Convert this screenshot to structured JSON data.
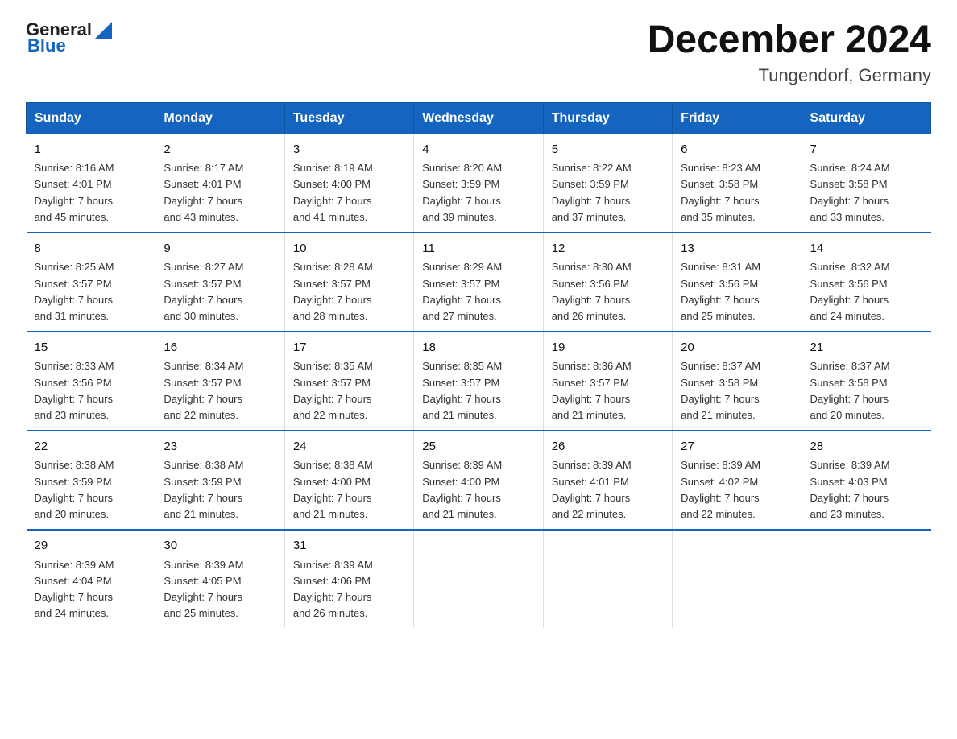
{
  "header": {
    "logo_general": "General",
    "logo_blue": "Blue",
    "title": "December 2024",
    "subtitle": "Tungendorf, Germany"
  },
  "weekdays": [
    "Sunday",
    "Monday",
    "Tuesday",
    "Wednesday",
    "Thursday",
    "Friday",
    "Saturday"
  ],
  "weeks": [
    [
      {
        "day": "1",
        "info": "Sunrise: 8:16 AM\nSunset: 4:01 PM\nDaylight: 7 hours\nand 45 minutes."
      },
      {
        "day": "2",
        "info": "Sunrise: 8:17 AM\nSunset: 4:01 PM\nDaylight: 7 hours\nand 43 minutes."
      },
      {
        "day": "3",
        "info": "Sunrise: 8:19 AM\nSunset: 4:00 PM\nDaylight: 7 hours\nand 41 minutes."
      },
      {
        "day": "4",
        "info": "Sunrise: 8:20 AM\nSunset: 3:59 PM\nDaylight: 7 hours\nand 39 minutes."
      },
      {
        "day": "5",
        "info": "Sunrise: 8:22 AM\nSunset: 3:59 PM\nDaylight: 7 hours\nand 37 minutes."
      },
      {
        "day": "6",
        "info": "Sunrise: 8:23 AM\nSunset: 3:58 PM\nDaylight: 7 hours\nand 35 minutes."
      },
      {
        "day": "7",
        "info": "Sunrise: 8:24 AM\nSunset: 3:58 PM\nDaylight: 7 hours\nand 33 minutes."
      }
    ],
    [
      {
        "day": "8",
        "info": "Sunrise: 8:25 AM\nSunset: 3:57 PM\nDaylight: 7 hours\nand 31 minutes."
      },
      {
        "day": "9",
        "info": "Sunrise: 8:27 AM\nSunset: 3:57 PM\nDaylight: 7 hours\nand 30 minutes."
      },
      {
        "day": "10",
        "info": "Sunrise: 8:28 AM\nSunset: 3:57 PM\nDaylight: 7 hours\nand 28 minutes."
      },
      {
        "day": "11",
        "info": "Sunrise: 8:29 AM\nSunset: 3:57 PM\nDaylight: 7 hours\nand 27 minutes."
      },
      {
        "day": "12",
        "info": "Sunrise: 8:30 AM\nSunset: 3:56 PM\nDaylight: 7 hours\nand 26 minutes."
      },
      {
        "day": "13",
        "info": "Sunrise: 8:31 AM\nSunset: 3:56 PM\nDaylight: 7 hours\nand 25 minutes."
      },
      {
        "day": "14",
        "info": "Sunrise: 8:32 AM\nSunset: 3:56 PM\nDaylight: 7 hours\nand 24 minutes."
      }
    ],
    [
      {
        "day": "15",
        "info": "Sunrise: 8:33 AM\nSunset: 3:56 PM\nDaylight: 7 hours\nand 23 minutes."
      },
      {
        "day": "16",
        "info": "Sunrise: 8:34 AM\nSunset: 3:57 PM\nDaylight: 7 hours\nand 22 minutes."
      },
      {
        "day": "17",
        "info": "Sunrise: 8:35 AM\nSunset: 3:57 PM\nDaylight: 7 hours\nand 22 minutes."
      },
      {
        "day": "18",
        "info": "Sunrise: 8:35 AM\nSunset: 3:57 PM\nDaylight: 7 hours\nand 21 minutes."
      },
      {
        "day": "19",
        "info": "Sunrise: 8:36 AM\nSunset: 3:57 PM\nDaylight: 7 hours\nand 21 minutes."
      },
      {
        "day": "20",
        "info": "Sunrise: 8:37 AM\nSunset: 3:58 PM\nDaylight: 7 hours\nand 21 minutes."
      },
      {
        "day": "21",
        "info": "Sunrise: 8:37 AM\nSunset: 3:58 PM\nDaylight: 7 hours\nand 20 minutes."
      }
    ],
    [
      {
        "day": "22",
        "info": "Sunrise: 8:38 AM\nSunset: 3:59 PM\nDaylight: 7 hours\nand 20 minutes."
      },
      {
        "day": "23",
        "info": "Sunrise: 8:38 AM\nSunset: 3:59 PM\nDaylight: 7 hours\nand 21 minutes."
      },
      {
        "day": "24",
        "info": "Sunrise: 8:38 AM\nSunset: 4:00 PM\nDaylight: 7 hours\nand 21 minutes."
      },
      {
        "day": "25",
        "info": "Sunrise: 8:39 AM\nSunset: 4:00 PM\nDaylight: 7 hours\nand 21 minutes."
      },
      {
        "day": "26",
        "info": "Sunrise: 8:39 AM\nSunset: 4:01 PM\nDaylight: 7 hours\nand 22 minutes."
      },
      {
        "day": "27",
        "info": "Sunrise: 8:39 AM\nSunset: 4:02 PM\nDaylight: 7 hours\nand 22 minutes."
      },
      {
        "day": "28",
        "info": "Sunrise: 8:39 AM\nSunset: 4:03 PM\nDaylight: 7 hours\nand 23 minutes."
      }
    ],
    [
      {
        "day": "29",
        "info": "Sunrise: 8:39 AM\nSunset: 4:04 PM\nDaylight: 7 hours\nand 24 minutes."
      },
      {
        "day": "30",
        "info": "Sunrise: 8:39 AM\nSunset: 4:05 PM\nDaylight: 7 hours\nand 25 minutes."
      },
      {
        "day": "31",
        "info": "Sunrise: 8:39 AM\nSunset: 4:06 PM\nDaylight: 7 hours\nand 26 minutes."
      },
      {
        "day": "",
        "info": ""
      },
      {
        "day": "",
        "info": ""
      },
      {
        "day": "",
        "info": ""
      },
      {
        "day": "",
        "info": ""
      }
    ]
  ]
}
